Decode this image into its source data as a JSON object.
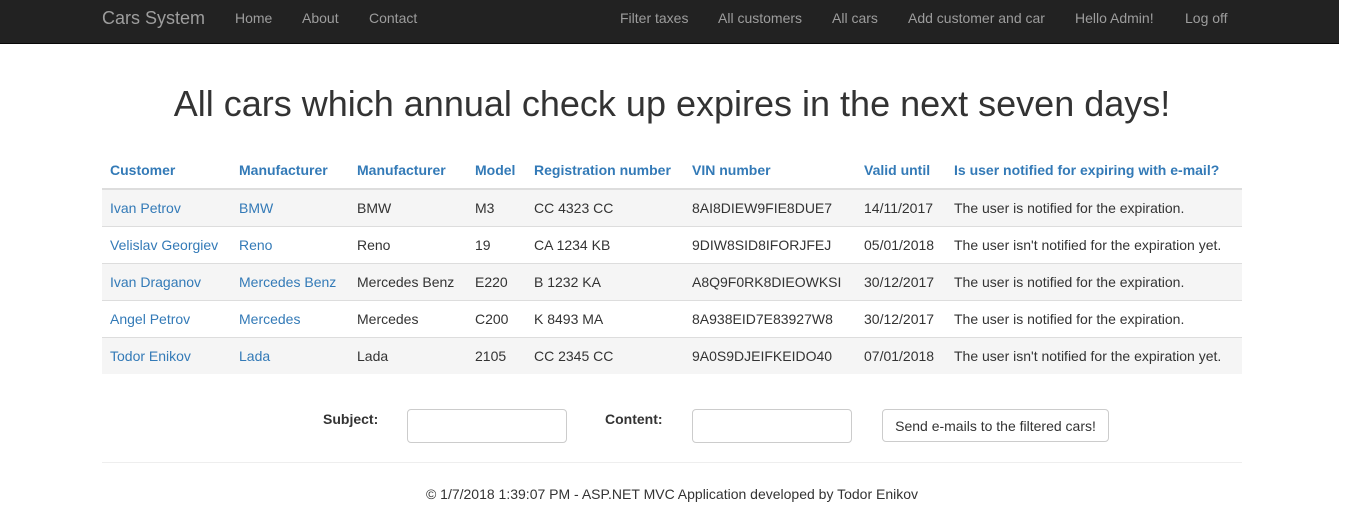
{
  "navbar": {
    "brand": "Cars System",
    "left_links": [
      "Home",
      "About",
      "Contact"
    ],
    "right_links": [
      "Filter taxes",
      "All customers",
      "All cars",
      "Add customer and car",
      "Hello Admin!",
      "Log off"
    ]
  },
  "page_title": "All cars which annual check up expires in the next seven days!",
  "table": {
    "headers": [
      "Customer",
      "Manufacturer",
      "Manufacturer",
      "Model",
      "Registration number",
      "VIN number",
      "Valid until",
      "Is user notified for expiring with e-mail?"
    ],
    "rows": [
      [
        "Ivan Petrov",
        "BMW",
        "BMW",
        "M3",
        "CC 4323 CC",
        "8AI8DIEW9FIE8DUE7",
        "14/11/2017",
        "The user is notified for the expiration."
      ],
      [
        "Velislav Georgiev",
        "Reno",
        "Reno",
        "19",
        "CA 1234 KB",
        "9DIW8SID8IFORJFEJ",
        "05/01/2018",
        "The user isn't notified for the expiration yet."
      ],
      [
        "Ivan Draganov",
        "Mercedes Benz",
        "Mercedes Benz",
        "E220",
        "B 1232 KA",
        "A8Q9F0RK8DIEOWKSI",
        "30/12/2017",
        "The user is notified for the expiration."
      ],
      [
        "Angel Petrov",
        "Mercedes",
        "Mercedes",
        "C200",
        "K 8493 MA",
        "8A938EID7E83927W8",
        "30/12/2017",
        "The user is notified for the expiration."
      ],
      [
        "Todor Enikov",
        "Lada",
        "Lada",
        "2105",
        "CC 2345 CC",
        "9A0S9DJEIFKEIDO40",
        "07/01/2018",
        "The user isn't notified for the expiration yet."
      ]
    ]
  },
  "form": {
    "subject_label": "Subject:",
    "subject_value": "",
    "content_label": "Content:",
    "content_value": "",
    "send_button": "Send e-mails to the filtered cars!"
  },
  "footer": "© 1/7/2018 1:39:07 PM - ASP.NET MVC Application developed by Todor Enikov",
  "colors": {
    "navbar_bg": "#222222",
    "navbar_link": "#9d9d9d",
    "link": "#337ab7",
    "stripe": "#f5f5f5"
  }
}
